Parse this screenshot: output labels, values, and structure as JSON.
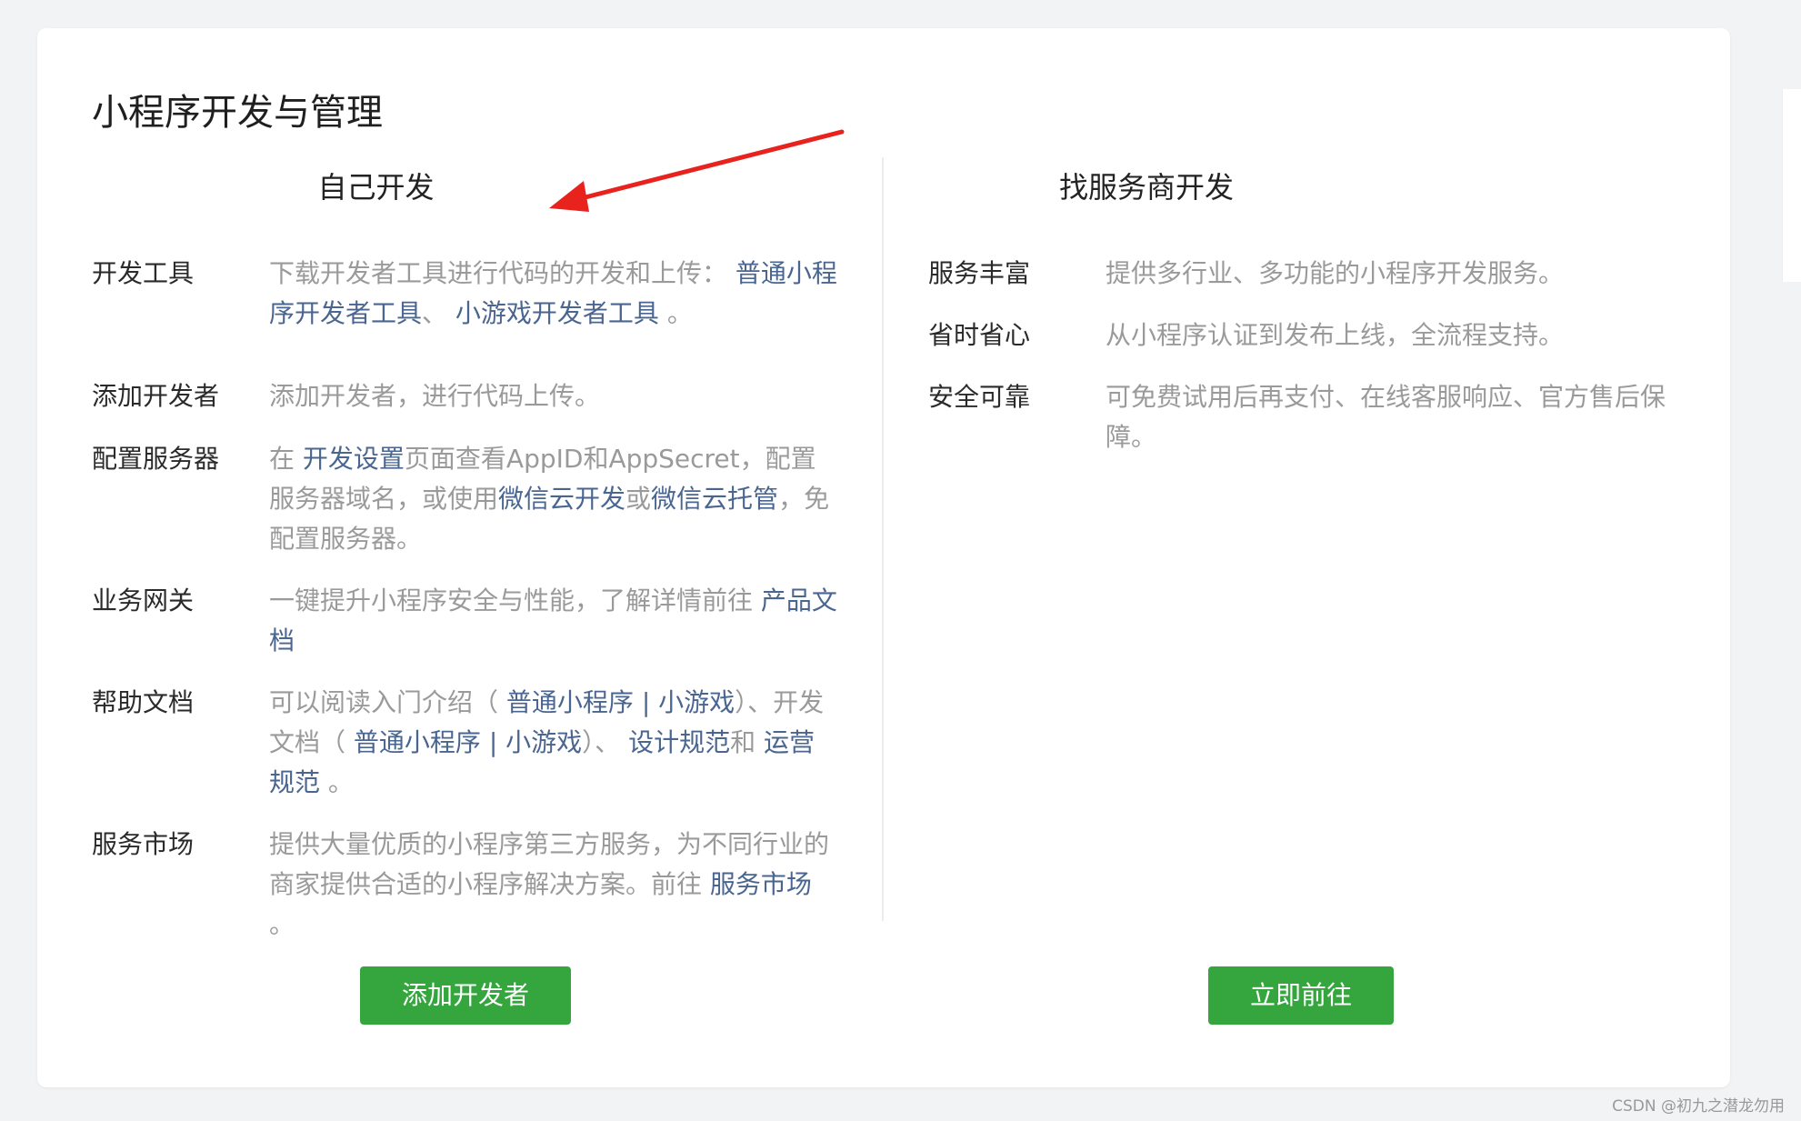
{
  "page_title": "小程序开发与管理",
  "self_dev": {
    "title": "自己开发",
    "rows": [
      {
        "label": "开发工具",
        "parts": [
          {
            "t": "下载开发者工具进行代码的开发和上传： "
          },
          {
            "t": "普通小程序开发者工具",
            "link": true
          },
          {
            "t": "、 "
          },
          {
            "t": "小游戏开发者工具",
            "link": true
          },
          {
            "t": " 。"
          }
        ]
      },
      {
        "label": "添加开发者",
        "parts": [
          {
            "t": "添加开发者，进行代码上传。"
          }
        ]
      },
      {
        "label": "配置服务器",
        "parts": [
          {
            "t": "在 "
          },
          {
            "t": "开发设置",
            "link": true
          },
          {
            "t": "页面查看AppID和AppSecret，配置服务器域名，或使用"
          },
          {
            "t": "微信云开发",
            "link": true
          },
          {
            "t": "或"
          },
          {
            "t": "微信云托管",
            "link": true
          },
          {
            "t": "，免配置服务器。"
          }
        ]
      },
      {
        "label": "业务网关",
        "parts": [
          {
            "t": "一键提升小程序安全与性能，了解详情前往 "
          },
          {
            "t": "产品文档",
            "link": true
          }
        ]
      },
      {
        "label": "帮助文档",
        "parts": [
          {
            "t": "可以阅读入门介绍（ "
          },
          {
            "t": "普通小程序",
            "link": true
          },
          {
            "t": " | ",
            "link": true
          },
          {
            "t": "小游戏",
            "link": true
          },
          {
            "t": "）、开发文档（ "
          },
          {
            "t": "普通小程序",
            "link": true
          },
          {
            "t": " | ",
            "link": true
          },
          {
            "t": "小游戏",
            "link": true
          },
          {
            "t": "）、 "
          },
          {
            "t": "设计规范",
            "link": true
          },
          {
            "t": "和 "
          },
          {
            "t": "运营规范",
            "link": true
          },
          {
            "t": " 。"
          }
        ]
      },
      {
        "label": "服务市场",
        "parts": [
          {
            "t": "提供大量优质的小程序第三方服务，为不同行业的商家提供合适的小程序解决方案。前往 "
          },
          {
            "t": "服务市场",
            "link": true
          },
          {
            "t": " 。"
          }
        ]
      }
    ],
    "button_label": "添加开发者"
  },
  "provider_dev": {
    "title": "找服务商开发",
    "rows": [
      {
        "label": "服务丰富",
        "parts": [
          {
            "t": "提供多行业、多功能的小程序开发服务。"
          }
        ]
      },
      {
        "label": "省时省心",
        "parts": [
          {
            "t": "从小程序认证到发布上线，全流程支持。"
          }
        ]
      },
      {
        "label": "安全可靠",
        "parts": [
          {
            "t": "可免费试用后再支付、在线客服响应、官方售后保障。"
          }
        ]
      }
    ],
    "button_label": "立即前往"
  },
  "watermark": "CSDN @初九之潜龙勿用",
  "colors": {
    "accent_green": "#35a63d",
    "link_blue": "#4a6690",
    "arrow_red": "#e8231d"
  }
}
